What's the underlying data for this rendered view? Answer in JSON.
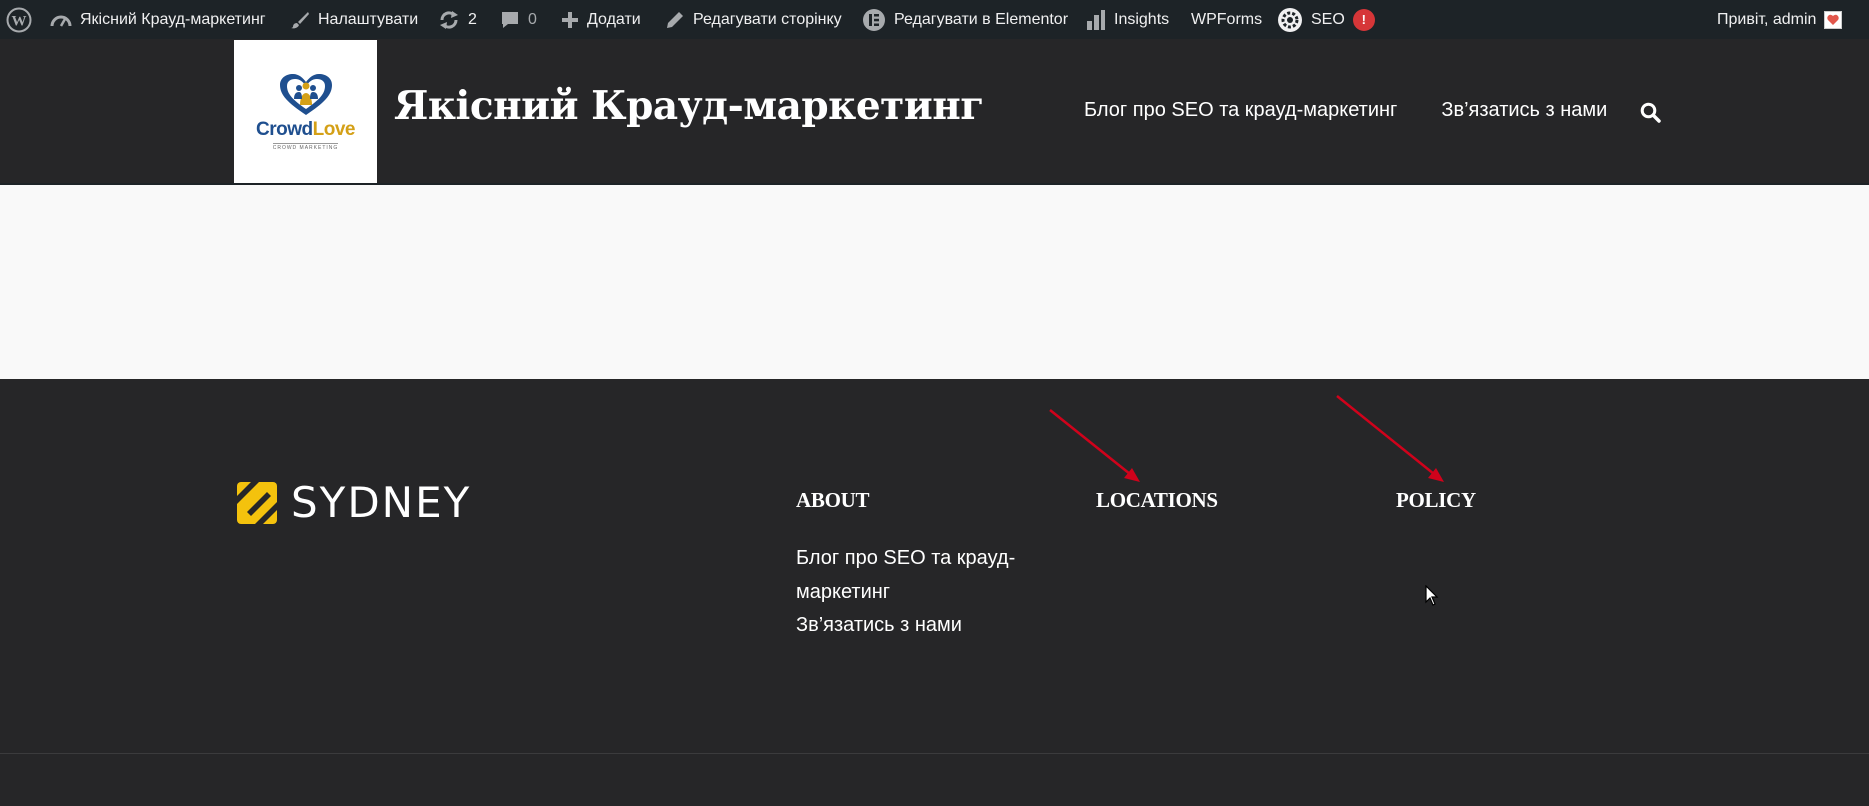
{
  "admin_bar": {
    "site_name": "Якісний Крауд-маркетинг",
    "customize": "Налаштувати",
    "updates_count": "2",
    "comments_count": "0",
    "new_label": "Додати",
    "edit_page": "Редагувати сторінку",
    "edit_elementor": "Редагувати в Elementor",
    "insights": "Insights",
    "wpforms": "WPForms",
    "seo": "SEO",
    "seo_badge": "!",
    "greeting": "Привіт, admin"
  },
  "header": {
    "logo": {
      "part1": "Crowd",
      "part2": "Love",
      "tagline": "CROWD MARKETING"
    },
    "site_title": "Якісний Крауд-маркетинг",
    "nav": [
      "Блог про SEO та крауд-маркетинг",
      "Зв’язатись з нами"
    ]
  },
  "footer": {
    "brand": "SYDNEY",
    "widgets": {
      "about": "ABOUT",
      "locations": "LOCATIONS",
      "policy": "POLICY"
    },
    "about_menu": [
      "Блог про SEO та крауд-маркетинг",
      "Зв’язатись з нами"
    ]
  },
  "colors": {
    "admin_bar": "#1d2327",
    "header_bg": "#262628",
    "content_bg": "#f9f9f9",
    "accent_yellow": "#f4c20d",
    "annotation_red": "#d0021b",
    "seo_badge_red": "#d63638"
  },
  "icons": [
    "wordpress-icon",
    "dashboard-icon",
    "brush-icon",
    "refresh-icon",
    "comment-icon",
    "plus-icon",
    "pencil-icon",
    "elementor-icon",
    "bar-chart-icon",
    "seo-gear-icon",
    "search-icon"
  ]
}
